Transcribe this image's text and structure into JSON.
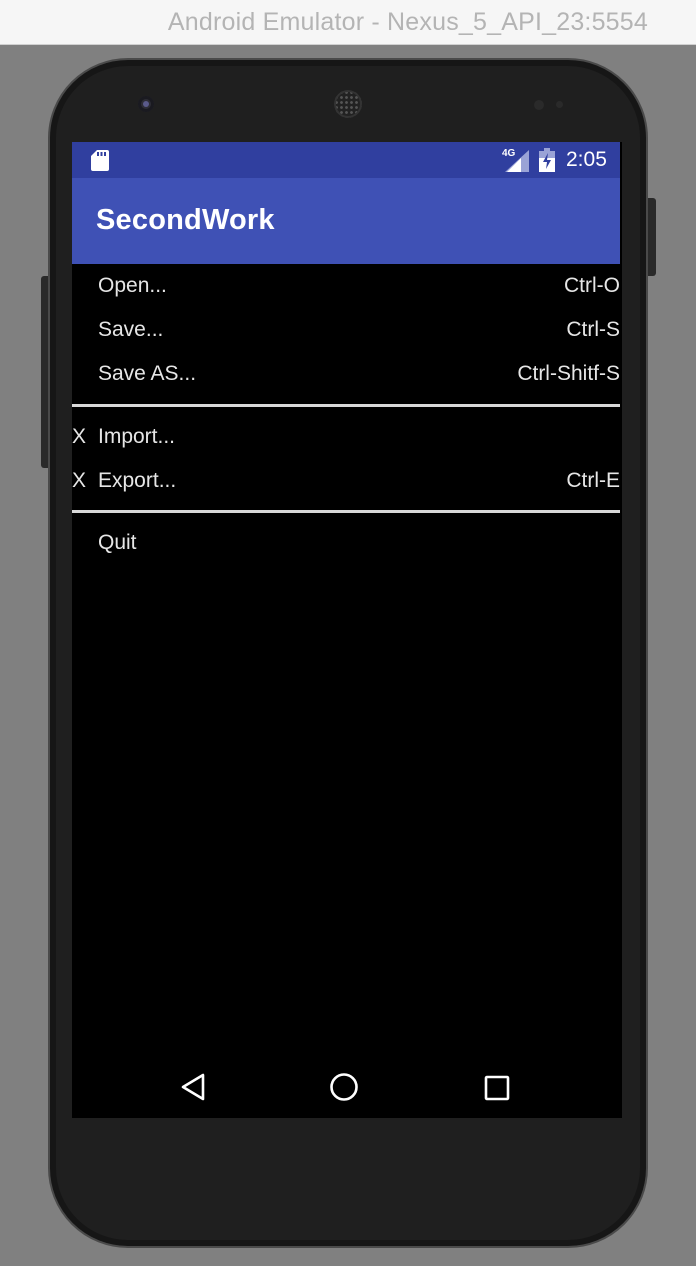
{
  "window": {
    "title": "Android Emulator - Nexus_5_API_23:5554"
  },
  "status_bar": {
    "network_label": "4G",
    "time": "2:05",
    "icons": [
      "sd-card-icon",
      "signal-icon",
      "battery-icon"
    ]
  },
  "app_bar": {
    "title": "SecondWork",
    "color": "#3f51b5",
    "status_color": "#303f9f"
  },
  "menu": {
    "items": [
      {
        "check": "",
        "label": "Open...",
        "shortcut": "Ctrl-O"
      },
      {
        "check": "",
        "label": "Save...",
        "shortcut": "Ctrl-S"
      },
      {
        "check": "",
        "label": "Save AS...",
        "shortcut": "Ctrl-Shitf-S"
      },
      {
        "check": "X",
        "label": "Import...",
        "shortcut": ""
      },
      {
        "check": "X",
        "label": "Export...",
        "shortcut": "Ctrl-E"
      },
      {
        "check": "",
        "label": "Quit",
        "shortcut": ""
      }
    ]
  },
  "nav_bar": {
    "icons": [
      "back-icon",
      "home-icon",
      "recents-icon"
    ]
  }
}
